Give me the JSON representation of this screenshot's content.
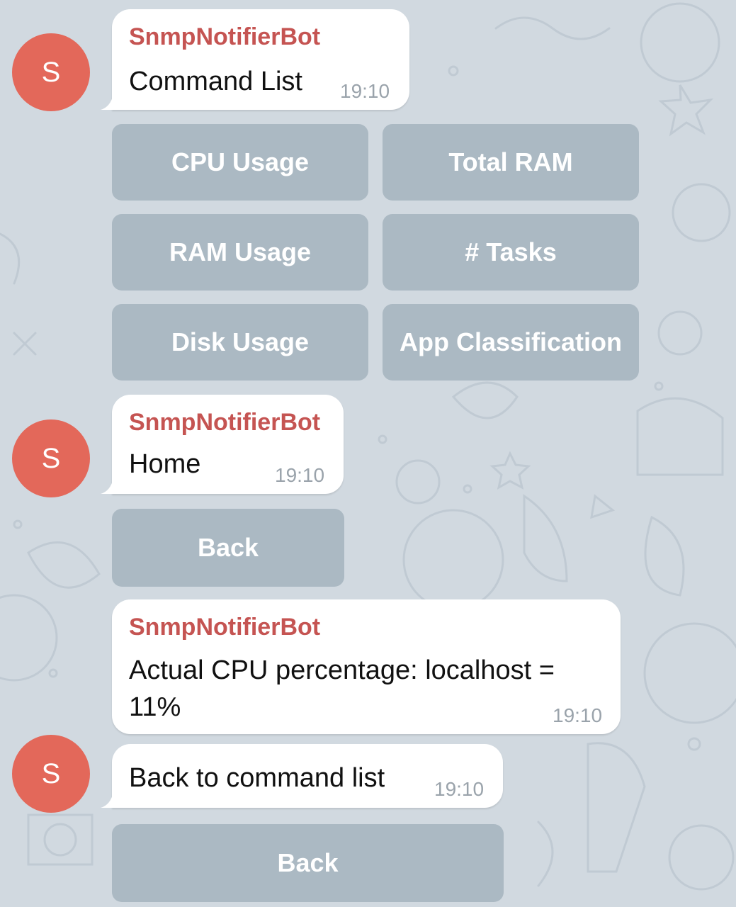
{
  "bot_name": "SnmpNotifierBot",
  "avatar_letter": "S",
  "colors": {
    "avatar": "#e3685a",
    "sender": "#c55452",
    "background": "#d1d9e0",
    "button": "#9eacb8"
  },
  "messages": [
    {
      "sender": "SnmpNotifierBot",
      "text": "Command List",
      "time": "19:10",
      "keyboard": [
        "CPU Usage",
        "Total RAM",
        "RAM Usage",
        "# Tasks",
        "Disk Usage",
        "App Classification"
      ]
    },
    {
      "sender": "SnmpNotifierBot",
      "text": "Home",
      "time": "19:10",
      "keyboard": [
        "Back"
      ]
    },
    {
      "sender": "SnmpNotifierBot",
      "text": "Actual CPU percentage: localhost = 11%",
      "time": "19:10"
    },
    {
      "text": "Back to command list",
      "time": "19:10",
      "keyboard": [
        "Back"
      ]
    }
  ]
}
